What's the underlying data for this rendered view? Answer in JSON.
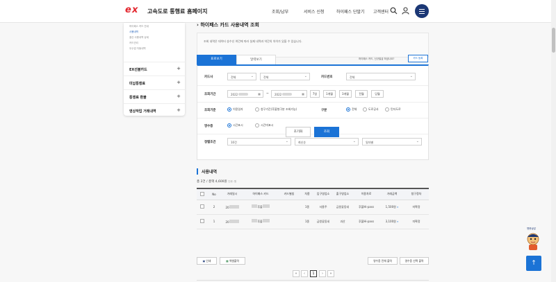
{
  "header": {
    "logo_mark_e": "e",
    "logo_mark_x": "x",
    "site_title": "고속도로 통행료 홈페이지",
    "nav": [
      "조회/납부",
      "서비스 신청",
      "하이패스 단말기",
      "고객센터"
    ],
    "brand_color": "#1b3775"
  },
  "sidebar": {
    "sub_items": [
      "하이패스 카드 안내",
      "사용내역",
      "결산 사용내역 상세",
      "카드관리",
      "우수업 자동내역"
    ],
    "active_index": 1,
    "menus": [
      "EX선불카드",
      "미납통행료",
      "통행료 환불",
      "영상작업 거래내역"
    ]
  },
  "main": {
    "page_title": "하이패스 카드 사용내역 조회",
    "notice": "조회 내역은 데이터 송수신 여건에 따라 실제 내역과 약간의 차이가 있을 수 있습니다.",
    "tabs": [
      "표로보기",
      "달력보기"
    ],
    "tab_note": "하이패스 카드, 신규발급 하셨나요?",
    "card_register": "카드 등록",
    "form": {
      "card_company_label": "카드사",
      "card_company_value": "전체",
      "card_type_value": "전체",
      "card_number_label": "카드번호",
      "card_number_value": "전체",
      "period_label": "조회기간",
      "date_from_prefix": "2022",
      "date_to_prefix": "2022",
      "date_sep": "~",
      "quick_ranges": [
        "7일",
        "1개월",
        "3개월",
        "전월",
        "당월"
      ],
      "basis_label": "조회기준",
      "basis_options": [
        "이용일자",
        "청구기간(후불형구분 조회가능)"
      ],
      "division_label": "구분",
      "division_options": [
        "전체",
        "도로공사",
        "민자도로"
      ],
      "receipt_label": "영수증",
      "receipt_options": [
        "시간표시",
        "시간미표시"
      ],
      "sort_label": "정렬조건",
      "sort_count": "10건",
      "sort_order": "최신순",
      "sort_type": "일자별",
      "reset_button": "초기화",
      "search_button": "조회"
    },
    "results": {
      "title": "사용내역",
      "summary": "총 2건 / 총액 4,600원",
      "summary_unit": "단위: 원",
      "columns": [
        "",
        "No",
        "거래일시",
        "하이패스 카드",
        "카드별칭",
        "차종",
        "입구영업소",
        "출구영업소",
        "이용차로",
        "거래금액",
        "청구정차"
      ],
      "rows": [
        {
          "no": "2",
          "date": "20",
          "card": "후불",
          "alias": "",
          "car": "1종",
          "entry": "서울주",
          "exit": "금왕꽃동네",
          "lane": "후불Hi-pass",
          "amount": "1,500원",
          "status": "미확정"
        },
        {
          "no": "1",
          "date": "20",
          "card": "후불",
          "alias": "",
          "car": "1종",
          "entry": "금왕꽃동네",
          "exit": "괴산",
          "lane": "후불Hi-pass",
          "amount": "3,100원",
          "status": "미확정"
        }
      ]
    },
    "bottom_buttons": {
      "print": "인쇄",
      "excel": "엑셀출력",
      "receipt_all": "영수증 전체 출력",
      "receipt_selected": "영수증 선택 출력"
    },
    "pagination": {
      "first": "«",
      "prev": "‹",
      "current": "1",
      "next": "›",
      "last": "»"
    }
  },
  "chatbot_label": "챗봇상담",
  "top_button": "↑",
  "accent_color": "#1b73d6"
}
